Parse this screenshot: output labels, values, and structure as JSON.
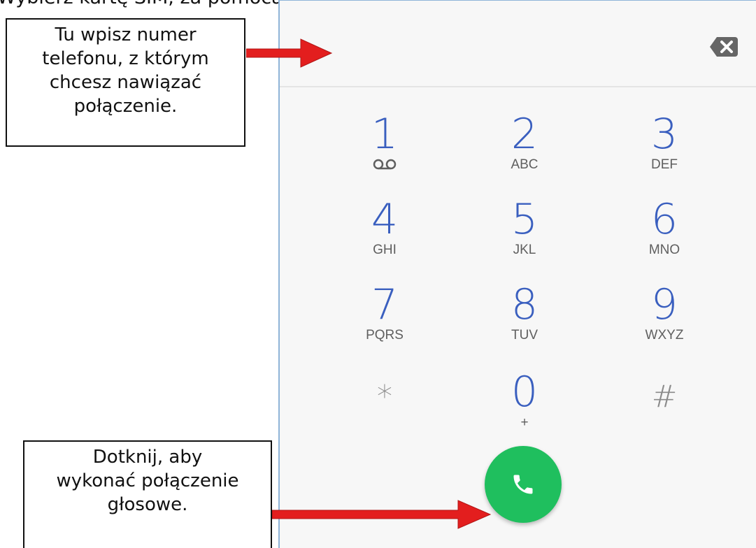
{
  "header_text": "Wybierz kartę SIM, za pomocą której chcesz wykonać połączenie głosowe.",
  "callouts": {
    "number_hint": [
      "Tu wpisz numer",
      "telefonu, z którym",
      "chcesz nawiązać",
      "połączenie."
    ],
    "call_hint": [
      "Dotknij, aby",
      "wykonać połączenie",
      "głosowe."
    ]
  },
  "dialer": {
    "number_value": "",
    "backspace_icon": "backspace-icon",
    "keys": [
      {
        "digit": "1",
        "letters": "",
        "icon": "voicemail-icon"
      },
      {
        "digit": "2",
        "letters": "ABC"
      },
      {
        "digit": "3",
        "letters": "DEF"
      },
      {
        "digit": "4",
        "letters": "GHI"
      },
      {
        "digit": "5",
        "letters": "JKL"
      },
      {
        "digit": "6",
        "letters": "MNO"
      },
      {
        "digit": "7",
        "letters": "PQRS"
      },
      {
        "digit": "8",
        "letters": "TUV"
      },
      {
        "digit": "9",
        "letters": "WXYZ"
      },
      {
        "digit": "*",
        "letters": ""
      },
      {
        "digit": "0",
        "letters": "+"
      },
      {
        "digit": "#",
        "letters": ""
      }
    ],
    "call_icon": "phone-icon"
  },
  "colors": {
    "digit": "#3a5fbf",
    "call_button": "#1fbf5e",
    "arrow": "#e31e1e"
  }
}
